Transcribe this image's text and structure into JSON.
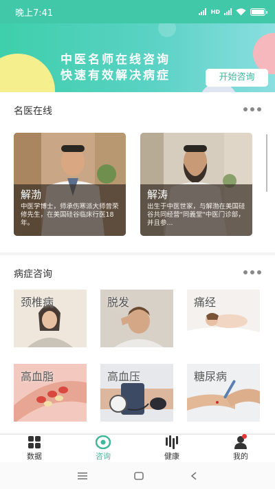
{
  "status_bar": {
    "time": "晚上7:41",
    "network": "HD"
  },
  "banner": {
    "line1": "中医名师在线咨询",
    "line2": "快速有效解决病症",
    "button": "开始咨询"
  },
  "doctors_section": {
    "title": "名医在线",
    "doctors": [
      {
        "name": "解渤",
        "desc": "中医学博士，师承伤寒派大师曾荣修先生，在美国硅谷临床行医18年。"
      },
      {
        "name": "解涛",
        "desc": "出生于中医世家，与解渤在美国硅谷共同经营\"同義堂\"中医门诊部，并且参..."
      }
    ]
  },
  "symptom_section": {
    "title": "病症咨询",
    "items": [
      {
        "label": "颈椎病"
      },
      {
        "label": "脱发"
      },
      {
        "label": "痛经"
      },
      {
        "label": "高血脂"
      },
      {
        "label": "高血压"
      },
      {
        "label": "糖尿病"
      }
    ]
  },
  "tabs": [
    {
      "label": "数据",
      "icon": "grid-icon"
    },
    {
      "label": "咨询",
      "icon": "consult-icon",
      "active": true
    },
    {
      "label": "健康",
      "icon": "health-icon"
    },
    {
      "label": "我的",
      "icon": "person-icon"
    }
  ],
  "colors": {
    "accent": "#3fb89a",
    "banner_start": "#3ecfab",
    "banner_end": "#8adee0",
    "badge": "#e23a3a"
  }
}
